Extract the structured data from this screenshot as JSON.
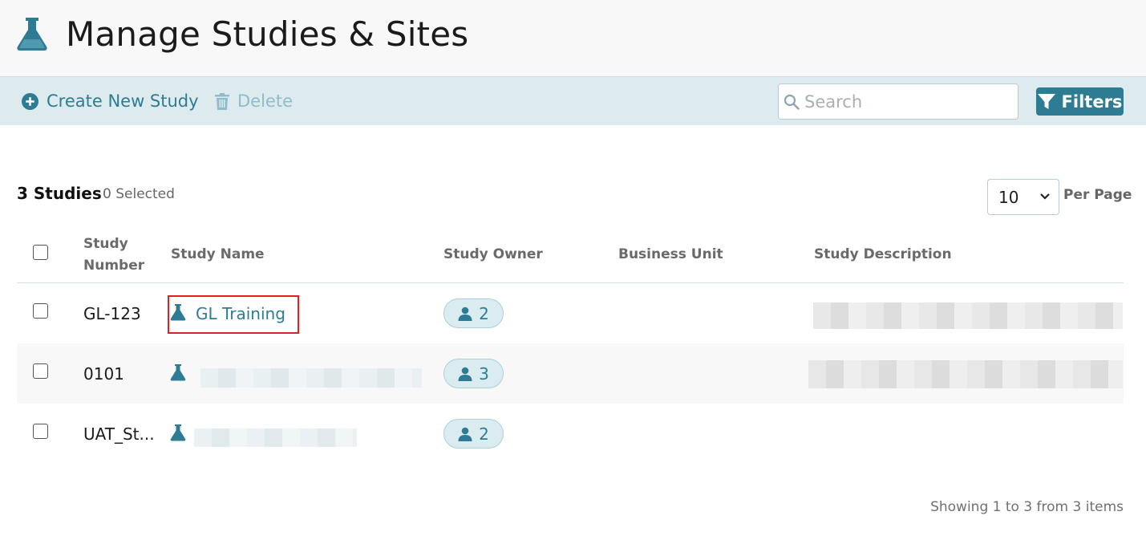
{
  "header": {
    "title": "Manage Studies & Sites",
    "logo_icon": "flask-icon"
  },
  "toolbar": {
    "create_label": "Create New Study",
    "delete_label": "Delete",
    "search_placeholder": "Search",
    "filters_label": "Filters"
  },
  "summary": {
    "count": "3 Studies",
    "selected": "0 Selected"
  },
  "pagination": {
    "per_page_value": "10",
    "per_page_label": "Per Page",
    "status": "Showing 1 to 3 from 3 items"
  },
  "columns": {
    "number_line1": "Study",
    "number_line2": "Number",
    "name": "Study Name",
    "owner": "Study Owner",
    "business_unit": "Business Unit",
    "description": "Study Description"
  },
  "rows": [
    {
      "number": "GL-123",
      "name": "GL Training",
      "owners": "2"
    },
    {
      "number": "0101",
      "name": "",
      "owners": "3"
    },
    {
      "number": "UAT_St...",
      "name": "",
      "owners": "2"
    }
  ],
  "colors": {
    "accent": "#2e7c93",
    "toolbar_bg": "#ddebef",
    "highlight": "#e02020"
  }
}
